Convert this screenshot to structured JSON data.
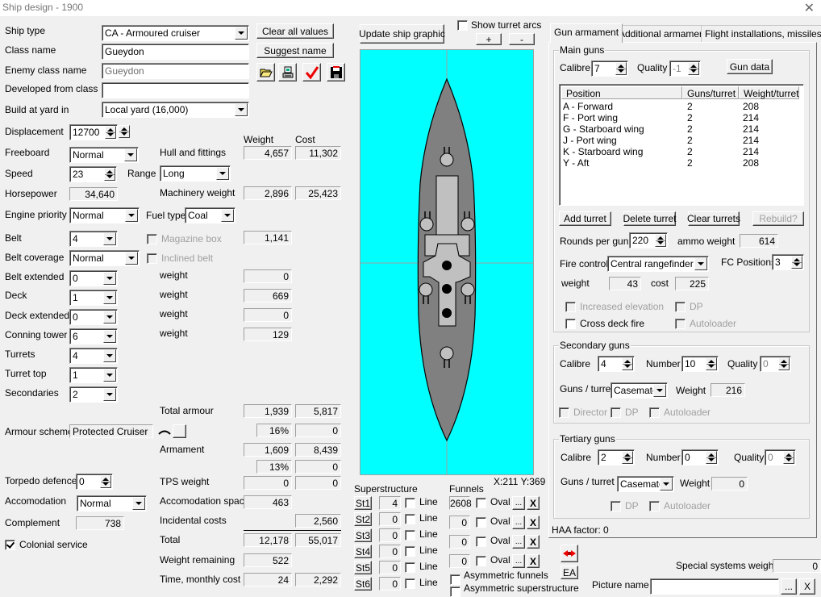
{
  "window": {
    "title": "Ship design - 1900",
    "close_glyph": "✕"
  },
  "left": {
    "ship_type": {
      "label": "Ship type",
      "value": "CA - Armoured cruiser"
    },
    "class_name": {
      "label": "Class name",
      "value": "Gueydon"
    },
    "enemy_class_name": {
      "label": "Enemy class name",
      "value": "Gueydon"
    },
    "developed_from": {
      "label": "Developed from class",
      "value": ""
    },
    "build_yard": {
      "label": "Build at yard in",
      "value": "Local yard (16,000)"
    },
    "displacement": {
      "label": "Displacement",
      "value": "12700"
    },
    "freeboard": {
      "label": "Freeboard",
      "value": "Normal"
    },
    "speed": {
      "label": "Speed",
      "value": "23"
    },
    "range": {
      "label": "Range",
      "value": "Long"
    },
    "horsepower": {
      "label": "Horsepower",
      "value": "34,640"
    },
    "engine_priority": {
      "label": "Engine priority",
      "value": "Normal"
    },
    "fuel_type": {
      "label": "Fuel type",
      "value": "Coal"
    },
    "belt": {
      "label": "Belt",
      "value": "4"
    },
    "belt_coverage": {
      "label": "Belt coverage",
      "value": "Normal"
    },
    "belt_extended": {
      "label": "Belt extended",
      "value": "0"
    },
    "deck": {
      "label": "Deck",
      "value": "1"
    },
    "deck_extended": {
      "label": "Deck extended",
      "value": "0"
    },
    "conning_tower": {
      "label": "Conning tower",
      "value": "6"
    },
    "turrets": {
      "label": "Turrets",
      "value": "4"
    },
    "turret_top": {
      "label": "Turret top",
      "value": "1"
    },
    "secondaries": {
      "label": "Secondaries",
      "value": "2"
    },
    "armour_scheme": {
      "label": "Armour scheme",
      "value": "Protected Cruiser"
    },
    "torpedo_defence": {
      "label": "Torpedo defence",
      "value": "0"
    },
    "accomodation": {
      "label": "Accomodation",
      "value": "Normal"
    },
    "complement": {
      "label": "Complement",
      "value": "738"
    },
    "colonial_service": {
      "label": "Colonial service",
      "checked": true
    }
  },
  "buttons": {
    "clear_all": "Clear all values",
    "suggest_name": "Suggest name",
    "update_graphic": "Update ship graphic",
    "zoom_in": "+",
    "zoom_out": "-"
  },
  "weights": {
    "weight_header": "Weight",
    "cost_header": "Cost",
    "hull": {
      "label": "Hull and fittings",
      "weight": "4,657",
      "cost": "11,302"
    },
    "machinery": {
      "label": "Machinery weight",
      "weight": "2,896",
      "cost": "25,423"
    },
    "magazine_box": {
      "label": "Magazine box",
      "weight": "1,141"
    },
    "inclined_belt": {
      "label": "Inclined belt"
    },
    "belt_ext_weight": {
      "label": "weight",
      "value": "0"
    },
    "deck_weight": {
      "label": "weight",
      "value": "669"
    },
    "deck_ext_weight": {
      "label": "weight",
      "value": "0"
    },
    "ct_weight": {
      "label": "weight",
      "value": "129"
    },
    "total_armour": {
      "label": "Total armour",
      "weight": "1,939",
      "cost": "5,817"
    },
    "armour_pct": {
      "pct": "16%",
      "cost": "0"
    },
    "armament": {
      "label": "Armament",
      "weight": "1,609",
      "cost": "8,439"
    },
    "armament_pct": {
      "pct": "13%",
      "cost": "0"
    },
    "tps": {
      "label": "TPS weight",
      "weight": "0",
      "cost": "0"
    },
    "accomodation_space": {
      "label": "Accomodation space",
      "weight": "463"
    },
    "incidental": {
      "label": "Incidental costs",
      "cost": "2,560"
    },
    "total": {
      "label": "Total",
      "weight": "12,178",
      "cost": "55,017"
    },
    "remaining": {
      "label": "Weight remaining",
      "weight": "522"
    },
    "time_cost": {
      "label": "Time, monthly cost",
      "weight": "24",
      "cost": "2,292"
    }
  },
  "graphic": {
    "show_turret_arcs": {
      "label": "Show turret arcs",
      "checked": false
    },
    "coords": "X:211 Y:369",
    "sea_color": "#00ffff",
    "hull_color": "#808080",
    "superstructure_color": "#c0c0c0"
  },
  "superstructure": {
    "title": "Superstructure",
    "rows": [
      {
        "button": "St1",
        "value": "4",
        "line": "Line"
      },
      {
        "button": "St2",
        "value": "0",
        "line": "Line"
      },
      {
        "button": "St3",
        "value": "0",
        "line": "Line"
      },
      {
        "button": "St4",
        "value": "0",
        "line": "Line"
      },
      {
        "button": "St5",
        "value": "0",
        "line": "Line"
      },
      {
        "button": "St6",
        "value": "0",
        "line": "Line"
      }
    ]
  },
  "funnels": {
    "title": "Funnels",
    "rows": [
      {
        "value": "2608",
        "oval": "Oval",
        "more": "...",
        "del": "X"
      },
      {
        "value": "0",
        "oval": "Oval",
        "more": "...",
        "del": "X"
      },
      {
        "value": "0",
        "oval": "Oval",
        "more": "...",
        "del": "X"
      },
      {
        "value": "0",
        "oval": "Oval",
        "more": "...",
        "del": "X"
      }
    ],
    "asym_funnels": "Asymmetric funnels",
    "asym_super": "Asymmetric superstructure"
  },
  "tabs": [
    {
      "label": "Gun armament",
      "active": true
    },
    {
      "label": "Additional armament",
      "active": false
    },
    {
      "label": "Flight installations, missiles",
      "active": false
    }
  ],
  "main_guns": {
    "title": "Main guns",
    "calibre_label": "Calibre",
    "calibre": "7",
    "quality_label": "Quality",
    "quality": "-1",
    "gun_data": "Gun data",
    "columns": [
      "Position",
      "Guns/turret",
      "Weight/turret"
    ],
    "turrets": [
      {
        "position": "A - Forward",
        "guns": "2",
        "weight": "208"
      },
      {
        "position": "F - Port wing",
        "guns": "2",
        "weight": "214"
      },
      {
        "position": "G - Starboard wing",
        "guns": "2",
        "weight": "214"
      },
      {
        "position": "J - Port wing",
        "guns": "2",
        "weight": "214"
      },
      {
        "position": "K - Starboard wing",
        "guns": "2",
        "weight": "214"
      },
      {
        "position": "Y - Aft",
        "guns": "2",
        "weight": "208"
      }
    ],
    "add_turret": "Add turret",
    "delete_turret": "Delete turret",
    "clear_turrets": "Clear turrets",
    "rebuild": "Rebuild?",
    "rounds_label": "Rounds per gun",
    "rounds": "220",
    "ammo_label": "ammo weight",
    "ammo": "614",
    "fire_control_label": "Fire control",
    "fire_control": "Central rangefinder",
    "fc_positions_label": "FC Positions",
    "fc_positions": "3",
    "fc_weight_label": "weight",
    "fc_weight": "43",
    "fc_cost_label": "cost",
    "fc_cost": "225",
    "increased_elevation": "Increased elevation",
    "dp": "DP",
    "cross_deck": "Cross deck fire",
    "autoloader": "Autoloader"
  },
  "secondary_guns": {
    "title": "Secondary guns",
    "calibre_label": "Calibre",
    "calibre": "4",
    "number_label": "Number",
    "number": "10",
    "quality_label": "Quality",
    "quality": "0",
    "guns_turret_label": "Guns / turret",
    "guns_turret": "Casemates",
    "weight_label": "Weight",
    "weight": "216",
    "director": "Director",
    "dp": "DP",
    "autoloader": "Autoloader"
  },
  "tertiary_guns": {
    "title": "Tertiary guns",
    "calibre_label": "Calibre",
    "calibre": "2",
    "number_label": "Number",
    "number": "0",
    "quality_label": "Quality",
    "quality": "0",
    "guns_turret_label": "Guns / turret",
    "guns_turret": "Casemates",
    "weight_label": "Weight",
    "weight": "0",
    "dp": "DP",
    "autoloader": "Autoloader"
  },
  "haa_factor": "HAA factor: 0",
  "bottom": {
    "ea_button": "EA",
    "special_systems_label": "Special systems weight",
    "special_systems": "0",
    "picture_label": "Picture name",
    "picture_value": "",
    "browse": "...",
    "clear": "X"
  }
}
